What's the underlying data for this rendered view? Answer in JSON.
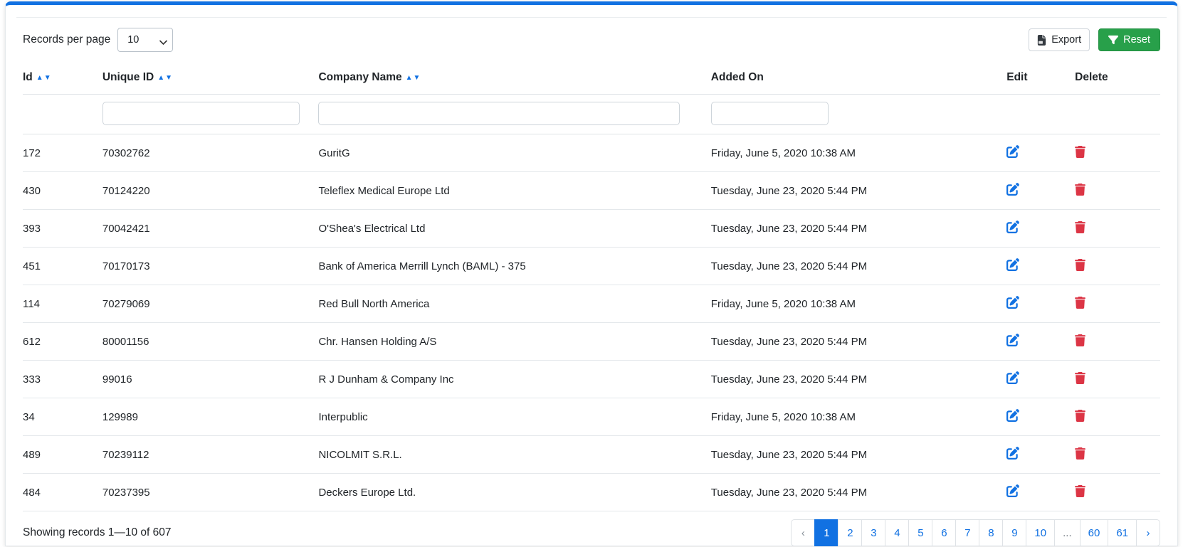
{
  "toolbar": {
    "records_per_page_label": "Records per page",
    "records_per_page_value": "10",
    "export_label": "Export",
    "reset_label": "Reset"
  },
  "table": {
    "columns": [
      {
        "label": "Id",
        "sortable": true
      },
      {
        "label": "Unique ID",
        "sortable": true
      },
      {
        "label": "Company Name",
        "sortable": true
      },
      {
        "label": "Added On",
        "sortable": false
      },
      {
        "label": "Edit",
        "sortable": false
      },
      {
        "label": "Delete",
        "sortable": false
      }
    ],
    "rows": [
      {
        "id": "172",
        "unique_id": "70302762",
        "company": "GuritG",
        "added_on": "Friday, June 5, 2020 10:38 AM"
      },
      {
        "id": "430",
        "unique_id": "70124220",
        "company": "Teleflex Medical Europe Ltd",
        "added_on": "Tuesday, June 23, 2020 5:44 PM"
      },
      {
        "id": "393",
        "unique_id": "70042421",
        "company": "O'Shea's Electrical Ltd",
        "added_on": "Tuesday, June 23, 2020 5:44 PM"
      },
      {
        "id": "451",
        "unique_id": "70170173",
        "company": "Bank of America Merrill Lynch (BAML) - 375",
        "added_on": "Tuesday, June 23, 2020 5:44 PM"
      },
      {
        "id": "114",
        "unique_id": "70279069",
        "company": "Red Bull North America",
        "added_on": "Friday, June 5, 2020 10:38 AM"
      },
      {
        "id": "612",
        "unique_id": "80001156",
        "company": "Chr. Hansen Holding A/S",
        "added_on": "Tuesday, June 23, 2020 5:44 PM"
      },
      {
        "id": "333",
        "unique_id": "99016",
        "company": "R J Dunham & Company Inc",
        "added_on": "Tuesday, June 23, 2020 5:44 PM"
      },
      {
        "id": "34",
        "unique_id": "129989",
        "company": "Interpublic",
        "added_on": "Friday, June 5, 2020 10:38 AM"
      },
      {
        "id": "489",
        "unique_id": "70239112",
        "company": "NICOLMIT S.R.L.",
        "added_on": "Tuesday, June 23, 2020 5:44 PM"
      },
      {
        "id": "484",
        "unique_id": "70237395",
        "company": "Deckers Europe Ltd.",
        "added_on": "Tuesday, June 23, 2020 5:44 PM"
      }
    ]
  },
  "footer": {
    "summary": "Showing records 1—10 of 607",
    "active_page": "1",
    "pagination": [
      "‹",
      "1",
      "2",
      "3",
      "4",
      "5",
      "6",
      "7",
      "8",
      "9",
      "10",
      "...",
      "60",
      "61",
      "›"
    ]
  },
  "icons": {
    "sort_asc": "▲",
    "sort_desc": "▼"
  },
  "colors": {
    "accent_blue": "#1171e2",
    "danger_red": "#dc3545",
    "success_green": "#28a04a"
  }
}
